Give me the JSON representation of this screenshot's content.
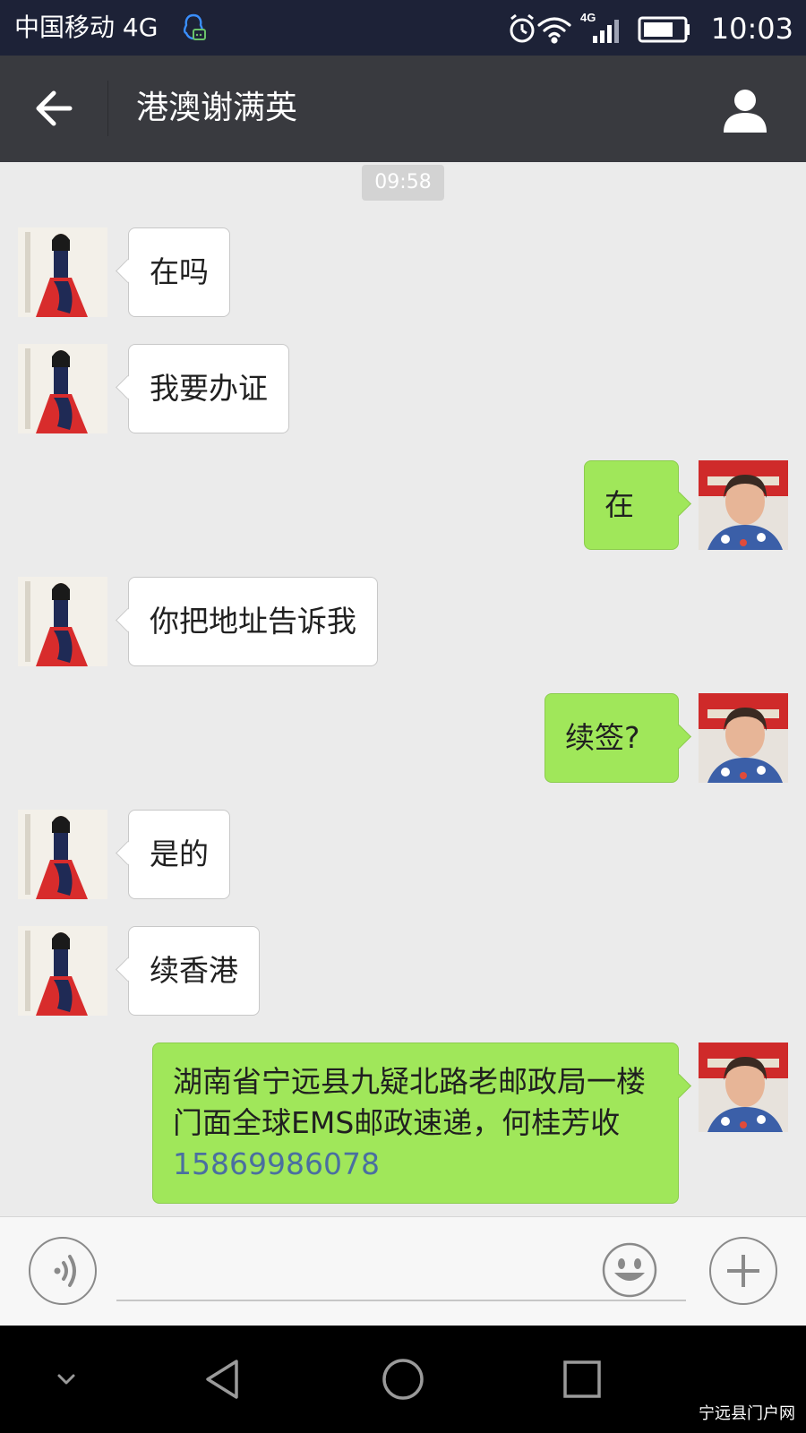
{
  "status_bar": {
    "carrier": "中国移动 4G",
    "network": "4G",
    "time": "10:03",
    "icons": [
      "qq-icon",
      "alarm-icon",
      "wifi-icon",
      "signal-icon",
      "battery-icon"
    ]
  },
  "header": {
    "title": "港澳谢满英",
    "icons": [
      "back-arrow-icon",
      "profile-icon"
    ]
  },
  "chat": {
    "timestamp": "09:58",
    "messages": [
      {
        "from": "contact",
        "text": "在吗"
      },
      {
        "from": "contact",
        "text": "我要办证"
      },
      {
        "from": "me",
        "text": "在"
      },
      {
        "from": "contact",
        "text": "你把地址告诉我"
      },
      {
        "from": "me",
        "text": "续签?"
      },
      {
        "from": "contact",
        "text": "是的"
      },
      {
        "from": "contact",
        "text": "续香港"
      },
      {
        "from": "me",
        "text": "湖南省宁远县九疑北路老邮政局一楼门面全球EMS邮政速递，何桂芳收",
        "phone": "15869986078"
      }
    ]
  },
  "input_bar": {
    "value": "",
    "icons": [
      "voice-icon",
      "emoji-icon",
      "plus-icon"
    ]
  },
  "nav_bar": {
    "icons": [
      "chevron-down-icon",
      "back-triangle-icon",
      "home-circle-icon",
      "recents-square-icon"
    ]
  },
  "watermark": "宁远县门户网",
  "colors": {
    "status_bar_bg": "#1d2237",
    "title_bar_bg": "#393a3f",
    "chat_bg": "#ebebeb",
    "outgoing_bubble": "#a0e75a",
    "incoming_bubble": "#ffffff",
    "link": "#4a6fa0"
  }
}
